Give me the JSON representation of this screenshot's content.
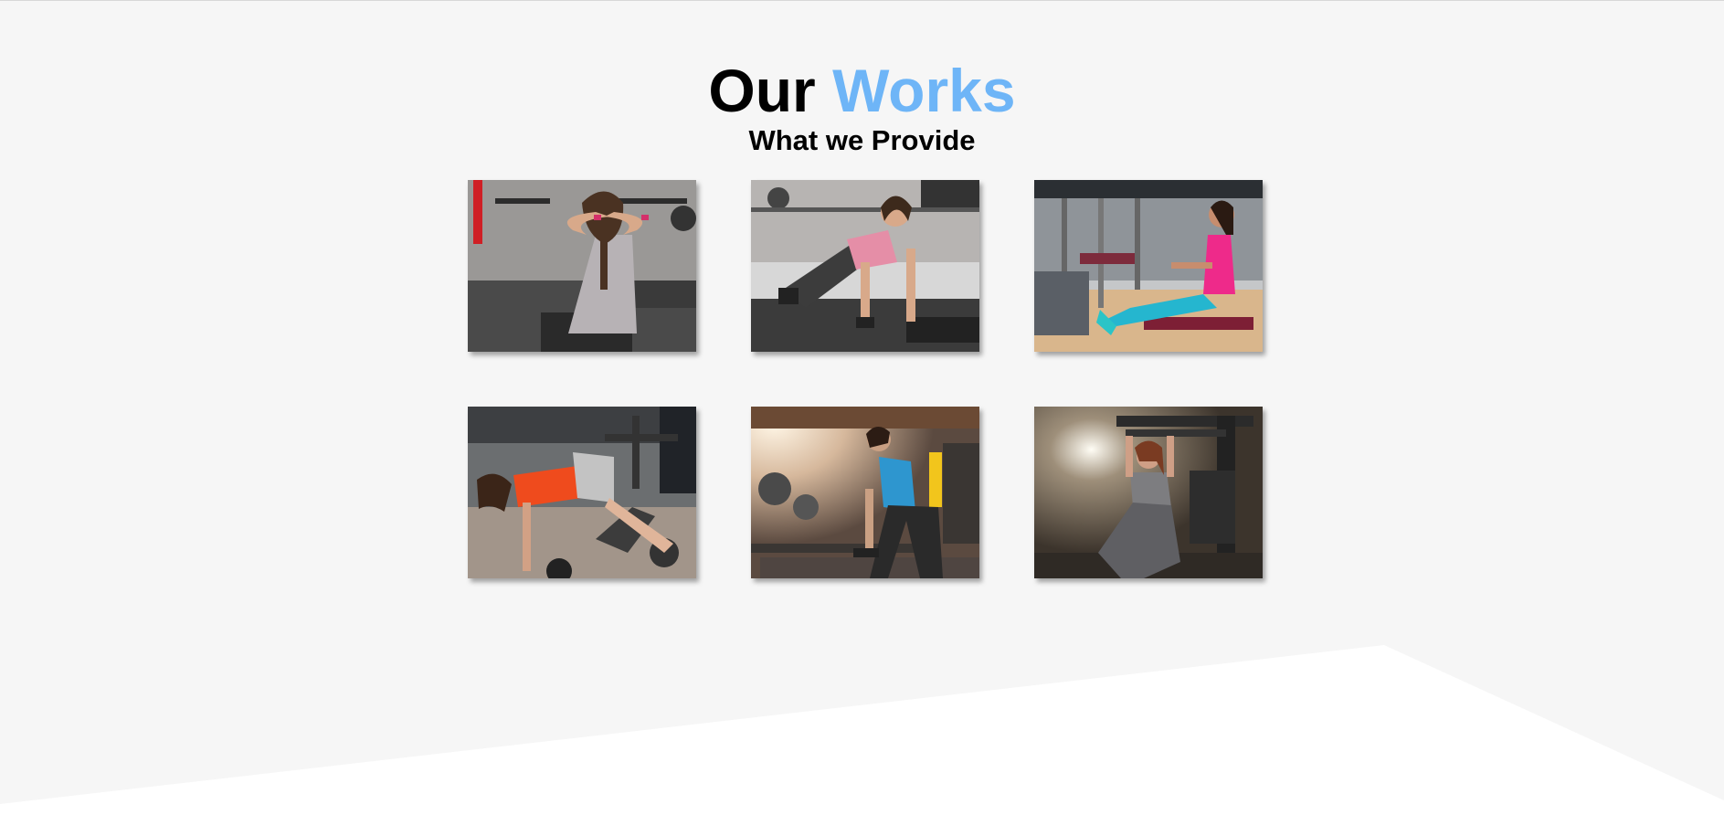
{
  "section": {
    "title_main": "Our",
    "title_accent": "Works",
    "subtitle": "What we Provide"
  },
  "colors": {
    "background": "#f6f6f6",
    "accent": "#6eb5f7",
    "bottom_shape": "#ffffff"
  },
  "gallery": [
    "gym-photo-woman-situps-bench",
    "gym-photo-woman-pushup",
    "gym-photo-woman-seated-row",
    "gym-photo-woman-back-extension",
    "gym-photo-woman-dumbbell-row",
    "gym-photo-woman-lat-pulldown"
  ]
}
